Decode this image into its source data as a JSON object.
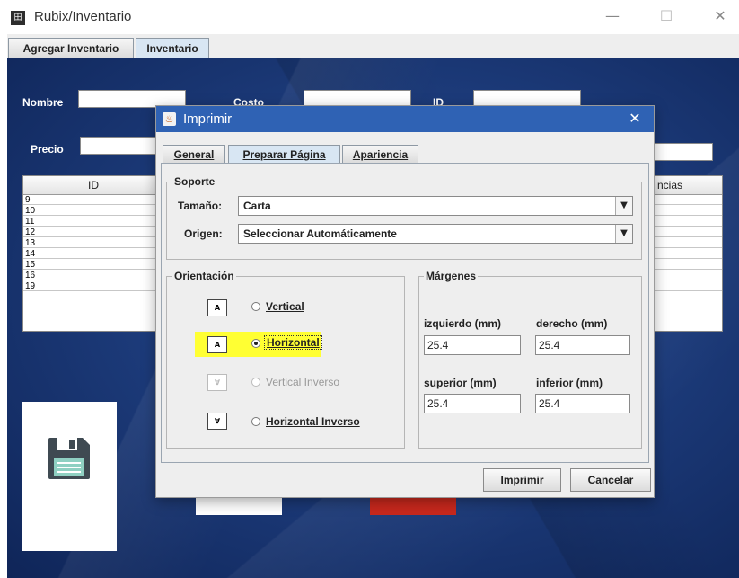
{
  "window": {
    "title": "Rubix/Inventario",
    "minimize": "—",
    "maximize": "☐",
    "close": "✕"
  },
  "main_tabs": [
    {
      "label": "Agregar Inventario"
    },
    {
      "label": "Inventario"
    }
  ],
  "form": {
    "nombre": "Nombre",
    "costo": "Costo",
    "id": "ID",
    "precio": "Precio"
  },
  "table": {
    "columns": [
      "ID",
      "ncias"
    ],
    "rows": [
      "9",
      "10",
      "11",
      "12",
      "13",
      "14",
      "15",
      "16",
      "19"
    ]
  },
  "dialog": {
    "title": "Imprimir",
    "close": "✕",
    "tabs": [
      {
        "label": "General"
      },
      {
        "label": "Preparar Página"
      },
      {
        "label": "Apariencia"
      }
    ],
    "soporte": {
      "title": "Soporte",
      "tamano_label": "Tamaño:",
      "tamano_value": "Carta",
      "origen_label": "Origen:",
      "origen_value": "Seleccionar Automáticamente"
    },
    "orientacion": {
      "title": "Orientación",
      "options": [
        {
          "label": "Vertical",
          "icon": "A",
          "selected": false,
          "enabled": true
        },
        {
          "label": "Horizontal",
          "icon": "A",
          "selected": true,
          "enabled": true
        },
        {
          "label": "Vertical Inverso",
          "icon": "∀",
          "selected": false,
          "enabled": false
        },
        {
          "label": "Horizontal Inverso",
          "icon": "∀",
          "selected": false,
          "enabled": true
        }
      ],
      "highlight_color": "#ffff33"
    },
    "margenes": {
      "title": "Márgenes",
      "izquierdo_label": "izquierdo (mm)",
      "izquierdo_value": "25.4",
      "derecho_label": "derecho (mm)",
      "derecho_value": "25.4",
      "superior_label": "superior (mm)",
      "superior_value": "25.4",
      "inferior_label": "inferior (mm)",
      "inferior_value": "25.4"
    },
    "buttons": {
      "print": "Imprimir",
      "cancel": "Cancelar"
    }
  },
  "colors": {
    "dialog_titlebar": "#2f62b4",
    "background": "#1d3c7c",
    "save_button_red": "#c7281d"
  }
}
